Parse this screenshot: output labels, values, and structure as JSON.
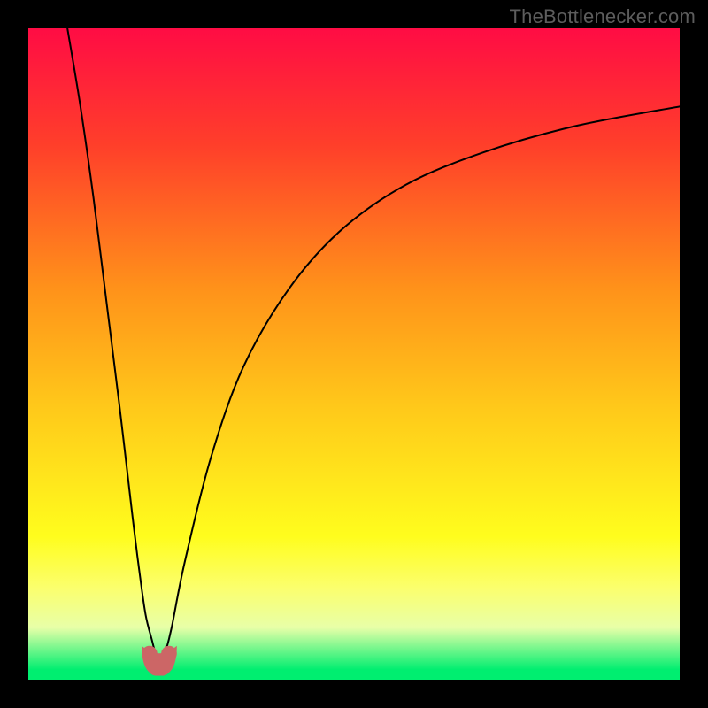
{
  "watermark": "TheBottlenecker.com",
  "chart_data": {
    "type": "line",
    "title": "",
    "xlabel": "",
    "ylabel": "",
    "xlim": [
      0,
      100
    ],
    "ylim": [
      0,
      100
    ],
    "grid": false,
    "legend": false,
    "gradient_stops": [
      {
        "pos": 0.0,
        "color": "#ff0c44"
      },
      {
        "pos": 0.18,
        "color": "#ff3f2a"
      },
      {
        "pos": 0.4,
        "color": "#ff921a"
      },
      {
        "pos": 0.58,
        "color": "#ffc81a"
      },
      {
        "pos": 0.78,
        "color": "#fffd1d"
      },
      {
        "pos": 0.86,
        "color": "#fbff6e"
      },
      {
        "pos": 0.92,
        "color": "#e8ffa8"
      },
      {
        "pos": 0.985,
        "color": "#00ee70"
      },
      {
        "pos": 1.0,
        "color": "#00ee70"
      }
    ],
    "curve_min_x": 20,
    "curve_left": {
      "description": "steep descending branch from top-left toward minimum",
      "x": [
        6,
        8,
        10,
        12,
        14,
        16,
        17,
        18,
        19,
        19.5
      ],
      "y": [
        100,
        88,
        74,
        58,
        42,
        25,
        17,
        10,
        6,
        4
      ]
    },
    "curve_right": {
      "description": "ascending branch from minimum toward upper-right, concave",
      "x": [
        21,
        22,
        24,
        28,
        33,
        40,
        48,
        58,
        70,
        84,
        100
      ],
      "y": [
        4,
        8,
        18,
        34,
        48,
        60,
        69,
        76,
        81,
        85,
        88
      ]
    },
    "markers": {
      "description": "small cluster of rounded pink markers at/near the minimum",
      "color": "#cc6666",
      "points": [
        {
          "x": 18.6,
          "y": 4.0
        },
        {
          "x": 19.6,
          "y": 1.8
        },
        {
          "x": 20.6,
          "y": 1.8
        },
        {
          "x": 21.6,
          "y": 4.0
        }
      ],
      "r": 1.2
    }
  }
}
